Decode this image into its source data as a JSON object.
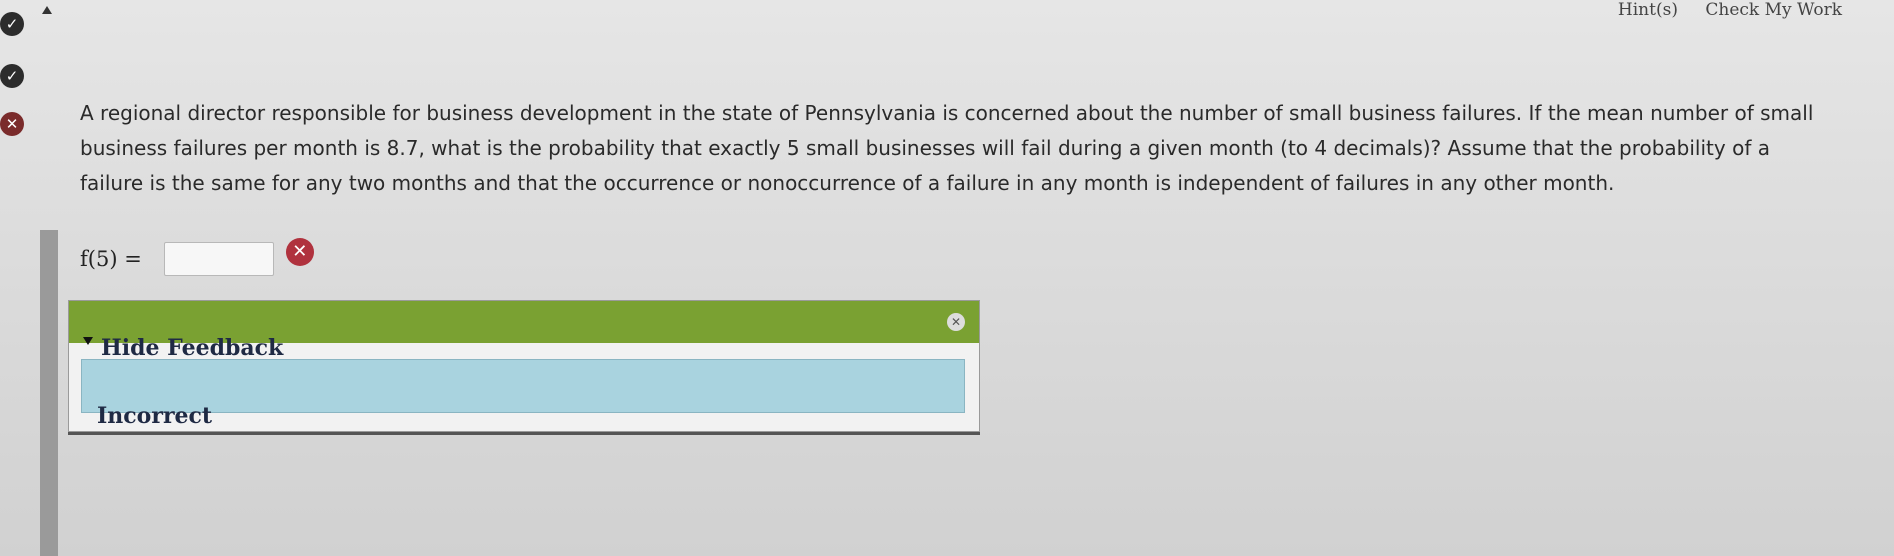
{
  "header": {
    "hints_label": "Hint(s)",
    "check_label": "Check My Work"
  },
  "status": {
    "dot1": "✓",
    "dot2": "✓",
    "dot3": "✕"
  },
  "question": {
    "line1": "A regional director responsible for business development in the state of Pennsylvania is concerned about the number of small business failures. If the mean number of small",
    "line2": "business failures per month is 8.7, what is the probability that exactly 5 small businesses will fail during a given month (to 4 decimals)? Assume that the probability of a",
    "line3": "failure is the same for any two months and that the occurrence or nonoccurrence of a failure in any month is independent of failures in any other month."
  },
  "answer": {
    "label": "f(5) =",
    "value": "",
    "status_icon": "✕"
  },
  "feedback": {
    "toggle_label": "Hide Feedback",
    "close_icon": "✕",
    "result": "Incorrect"
  },
  "colors": {
    "feedback_header": "#7aa132",
    "feedback_body": "#a9d3df",
    "wrong": "#b0323e"
  }
}
